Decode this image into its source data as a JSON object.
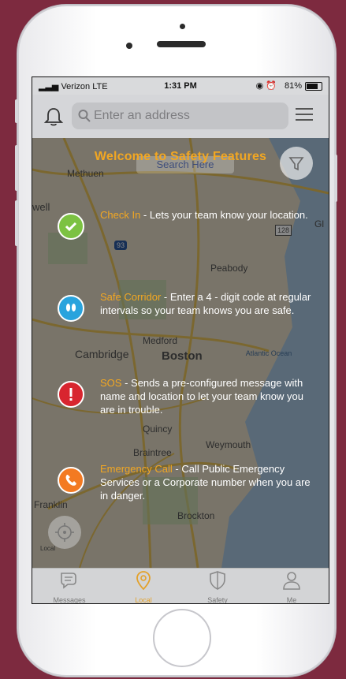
{
  "status_bar": {
    "carrier": "Verizon",
    "network": "LTE",
    "time": "1:31 PM",
    "battery": "81%"
  },
  "header": {
    "search_placeholder": "Enter an address"
  },
  "map": {
    "search_here": "Search Here",
    "labels": [
      "Methuen",
      "well",
      "Peabody",
      "Cambridge",
      "Medford",
      "Boston",
      "Atlantic Ocean",
      "Quincy",
      "Braintree",
      "Weymouth",
      "Franklin",
      "Brockton",
      "Gl",
      "128",
      "93",
      "Local"
    ]
  },
  "welcome": "Welcome to Safety Features",
  "features": [
    {
      "name": "Check In",
      "desc": " - Lets your team know your location.",
      "color": "#7cc242",
      "icon": "check-icon"
    },
    {
      "name": "Safe Corridor",
      "desc": " - Enter a 4 - digit code at regular intervals so your team knows you are safe.",
      "color": "#29a3dd",
      "icon": "footprints-icon"
    },
    {
      "name": "SOS",
      "desc": " - Sends a pre-configured message with name and location to let your team know you are in trouble.",
      "color": "#d8252f",
      "icon": "alert-icon"
    },
    {
      "name": "Emergency Call",
      "desc": " - Call Public Emergency Services or a Corporate number when you are in danger.",
      "color": "#f37a22",
      "icon": "phone-icon"
    }
  ],
  "tabs": [
    {
      "label": "Messages",
      "icon": "messages-icon",
      "active": false
    },
    {
      "label": "Local",
      "icon": "location-pin-icon",
      "active": true
    },
    {
      "label": "Safety",
      "icon": "shield-icon",
      "active": false
    },
    {
      "label": "Me",
      "icon": "person-icon",
      "active": false
    }
  ],
  "colors": {
    "accent": "#f2a722",
    "frame": "#7d2a3f"
  }
}
